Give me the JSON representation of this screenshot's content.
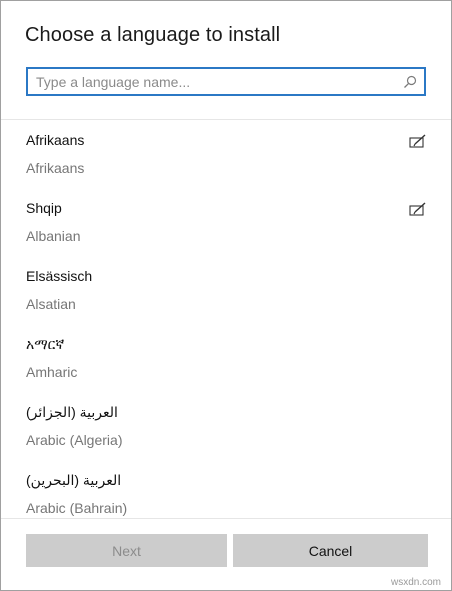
{
  "dialog": {
    "title": "Choose a language to install"
  },
  "search": {
    "placeholder": "Type a language name...",
    "value": "",
    "icon": "search-icon"
  },
  "languages": [
    {
      "native": "Afrikaans",
      "english": "Afrikaans",
      "handwriting": true
    },
    {
      "native": "Shqip",
      "english": "Albanian",
      "handwriting": true
    },
    {
      "native": "Elsässisch",
      "english": "Alsatian",
      "handwriting": false
    },
    {
      "native": "አማርኛ",
      "english": "Amharic",
      "handwriting": false
    },
    {
      "native": "العربية (الجزائر)",
      "english": "Arabic (Algeria)",
      "handwriting": false
    },
    {
      "native": "العربية (البحرين)",
      "english": "Arabic (Bahrain)",
      "handwriting": false
    }
  ],
  "buttons": {
    "next_label": "Next",
    "cancel_label": "Cancel"
  },
  "watermark": "wsxdn.com",
  "colors": {
    "accent": "#2b78c5",
    "button_bg": "#cccccc",
    "secondary_text": "#767676"
  }
}
